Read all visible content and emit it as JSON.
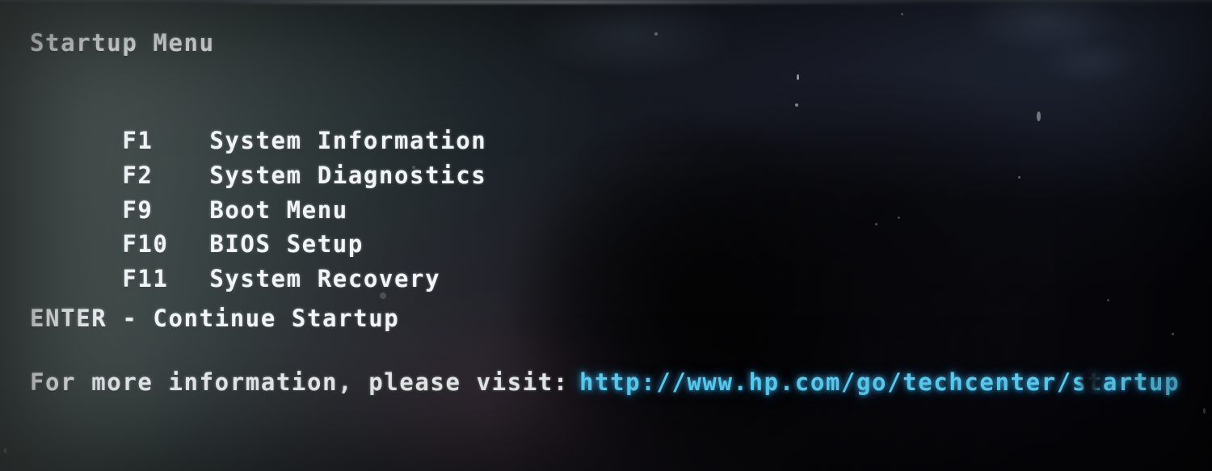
{
  "screen": {
    "title": "Startup Menu",
    "menu_items": [
      {
        "key": "F1",
        "label": "System Information"
      },
      {
        "key": "F2",
        "label": "System Diagnostics"
      },
      {
        "key": "F9",
        "label": "Boot Menu"
      },
      {
        "key": "F10",
        "label": "BIOS Setup"
      },
      {
        "key": "F11",
        "label": "System Recovery"
      }
    ],
    "continue_line": "ENTER - Continue Startup",
    "footer": {
      "prompt": "For more information, please visit:",
      "url": "http://www.hp.com/go/techcenter/startup"
    }
  },
  "colors": {
    "text": "#f2f5f7",
    "url": "#5fd8fb",
    "background_left": "#4d5755",
    "background_right": "#050508"
  }
}
